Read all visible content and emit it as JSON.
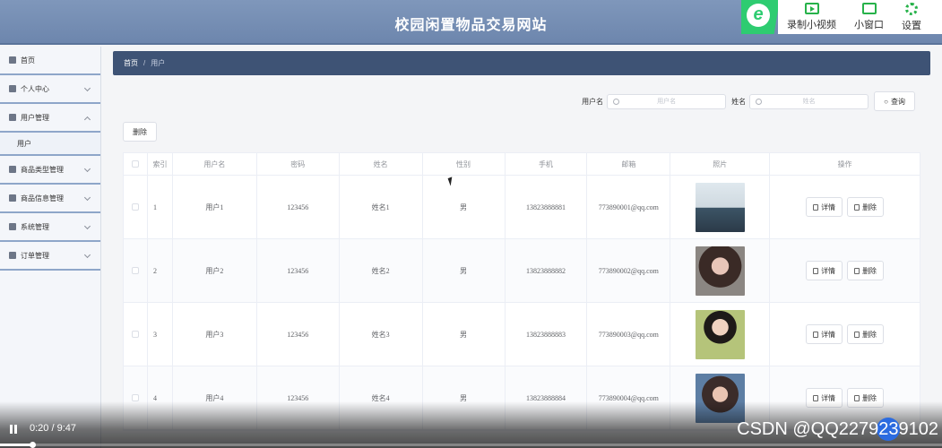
{
  "site": {
    "title": "校园闲置物品交易网站"
  },
  "toolbar": {
    "record_label": "录制小视频",
    "window_label": "小窗口",
    "settings_label": "设置",
    "badge": "e"
  },
  "sidebar": {
    "items": [
      {
        "label": "首页"
      },
      {
        "label": "个人中心"
      },
      {
        "label": "用户管理"
      },
      {
        "label": "用户"
      },
      {
        "label": "商品类型管理"
      },
      {
        "label": "商品信息管理"
      },
      {
        "label": "系统管理"
      },
      {
        "label": "订单管理"
      }
    ]
  },
  "breadcrumb": {
    "home": "首页",
    "sep": "/",
    "current": "用户"
  },
  "search": {
    "username_label": "用户名",
    "username_placeholder": "用户名",
    "name_label": "姓名",
    "name_placeholder": "姓名",
    "query_label": "查询"
  },
  "actions": {
    "delete_label": "删除"
  },
  "table": {
    "headers": [
      "",
      "索引",
      "用户名",
      "密码",
      "姓名",
      "性别",
      "手机",
      "邮箱",
      "照片",
      "操作"
    ],
    "rows": [
      {
        "index": "1",
        "username": "用户1",
        "password": "123456",
        "name": "姓名1",
        "gender": "男",
        "phone": "13823888881",
        "email": "773890001@qq.com",
        "detail": "详情",
        "delete": "删除"
      },
      {
        "index": "2",
        "username": "用户2",
        "password": "123456",
        "name": "姓名2",
        "gender": "男",
        "phone": "13823888882",
        "email": "773890002@qq.com",
        "detail": "详情",
        "delete": "删除"
      },
      {
        "index": "3",
        "username": "用户3",
        "password": "123456",
        "name": "姓名3",
        "gender": "男",
        "phone": "13823888883",
        "email": "773890003@qq.com",
        "detail": "详情",
        "delete": "删除"
      },
      {
        "index": "4",
        "username": "用户4",
        "password": "123456",
        "name": "姓名4",
        "gender": "男",
        "phone": "13823888884",
        "email": "773890004@qq.com",
        "detail": "详情",
        "delete": "删除"
      }
    ]
  },
  "video": {
    "time": "0:20 / 9:47",
    "progress": 0.034
  },
  "watermark": "CSDN @QQ2279239102"
}
